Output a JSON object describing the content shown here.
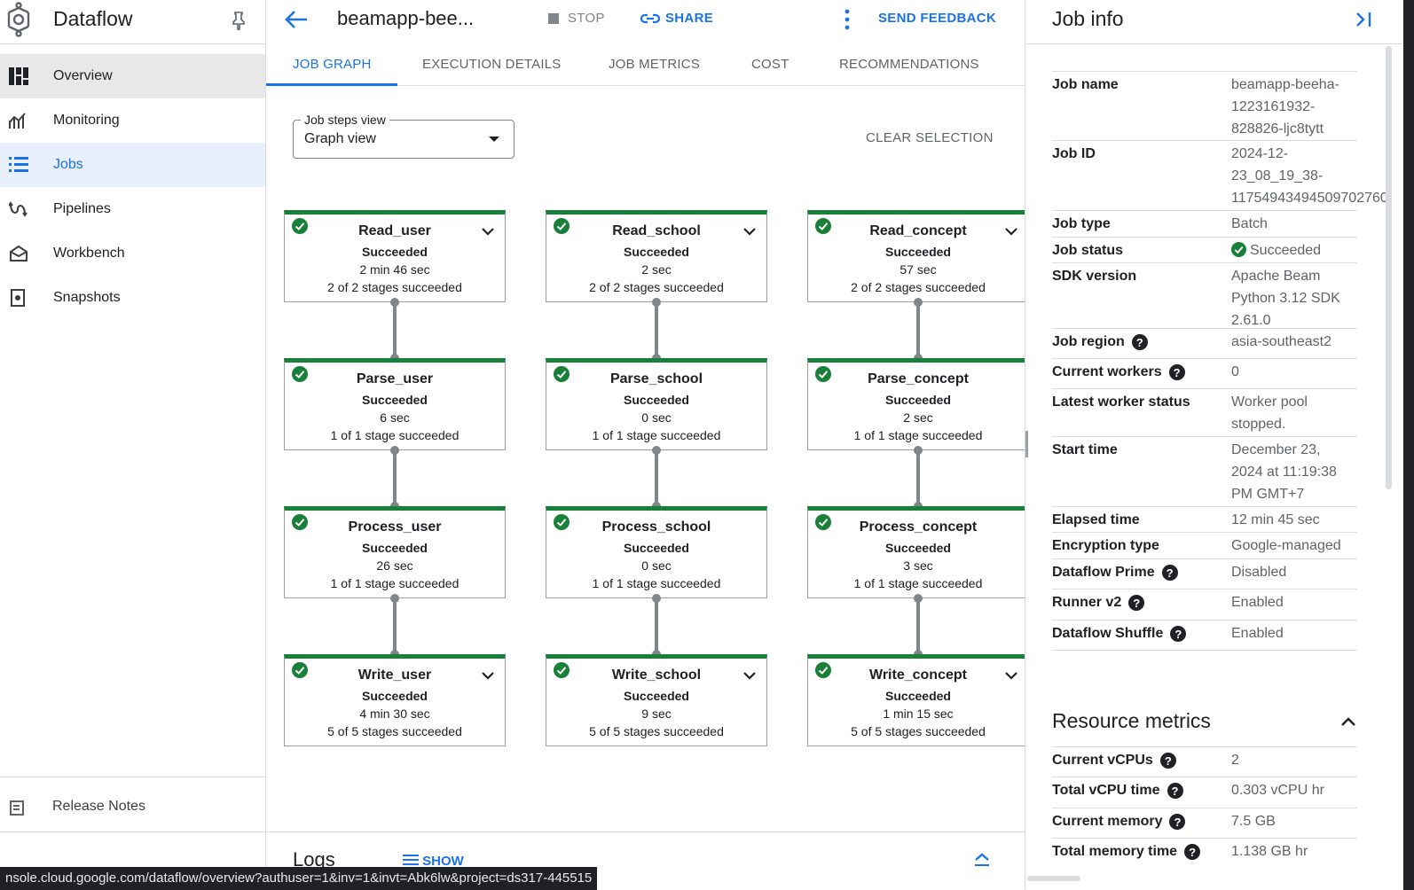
{
  "nav": {
    "title": "Dataflow",
    "items": [
      {
        "label": "Overview"
      },
      {
        "label": "Monitoring"
      },
      {
        "label": "Jobs"
      },
      {
        "label": "Pipelines"
      },
      {
        "label": "Workbench"
      },
      {
        "label": "Snapshots"
      }
    ],
    "release_notes": "Release Notes"
  },
  "header": {
    "job_title": "beamapp-bee...",
    "stop_label": "STOP",
    "share_label": "SHARE",
    "feedback_label": "SEND FEEDBACK"
  },
  "tabs": [
    {
      "label": "JOB GRAPH"
    },
    {
      "label": "EXECUTION DETAILS"
    },
    {
      "label": "JOB METRICS"
    },
    {
      "label": "COST"
    },
    {
      "label": "RECOMMENDATIONS"
    }
  ],
  "job_steps": {
    "label": "Job steps view",
    "value": "Graph view",
    "clear_label": "CLEAR SELECTION"
  },
  "graph": {
    "columns": [
      [
        {
          "name": "Read_user",
          "status": "Succeeded",
          "duration": "2 min 46 sec",
          "stages": "2 of 2 stages succeeded",
          "expandable": true
        },
        {
          "name": "Parse_user",
          "status": "Succeeded",
          "duration": "6 sec",
          "stages": "1 of 1 stage succeeded",
          "expandable": false
        },
        {
          "name": "Process_user",
          "status": "Succeeded",
          "duration": "26 sec",
          "stages": "1 of 1 stage succeeded",
          "expandable": false
        },
        {
          "name": "Write_user",
          "status": "Succeeded",
          "duration": "4 min 30 sec",
          "stages": "5 of 5 stages succeeded",
          "expandable": true
        }
      ],
      [
        {
          "name": "Read_school",
          "status": "Succeeded",
          "duration": "2 sec",
          "stages": "2 of 2 stages succeeded",
          "expandable": true
        },
        {
          "name": "Parse_school",
          "status": "Succeeded",
          "duration": "0 sec",
          "stages": "1 of 1 stage succeeded",
          "expandable": false
        },
        {
          "name": "Process_school",
          "status": "Succeeded",
          "duration": "0 sec",
          "stages": "1 of 1 stage succeeded",
          "expandable": false
        },
        {
          "name": "Write_school",
          "status": "Succeeded",
          "duration": "9 sec",
          "stages": "5 of 5 stages succeeded",
          "expandable": true
        }
      ],
      [
        {
          "name": "Read_concept",
          "status": "Succeeded",
          "duration": "57 sec",
          "stages": "2 of 2 stages succeeded",
          "expandable": true
        },
        {
          "name": "Parse_concept",
          "status": "Succeeded",
          "duration": "2 sec",
          "stages": "1 of 1 stage succeeded",
          "expandable": false
        },
        {
          "name": "Process_concept",
          "status": "Succeeded",
          "duration": "3 sec",
          "stages": "1 of 1 stage succeeded",
          "expandable": false
        },
        {
          "name": "Write_concept",
          "status": "Succeeded",
          "duration": "1 min 15 sec",
          "stages": "5 of 5 stages succeeded",
          "expandable": true
        }
      ]
    ]
  },
  "logs": {
    "title": "Logs",
    "show_label": "SHOW"
  },
  "job_info": {
    "title": "Job info",
    "rows": [
      {
        "key": "Job name",
        "value": "beamapp-beeha-1223161932-828826-ljc8tytt",
        "help": false
      },
      {
        "key": "Job ID",
        "value": "2024-12-23_08_19_38-11754943494509702760",
        "help": false
      },
      {
        "key": "Job type",
        "value": "Batch",
        "help": false
      },
      {
        "key": "Job status",
        "value": "Succeeded",
        "help": false,
        "status_icon": true
      },
      {
        "key": "SDK version",
        "value": "Apache Beam Python 3.12 SDK 2.61.0",
        "help": false
      },
      {
        "key": "Job region",
        "value": "asia-southeast2",
        "help": true
      },
      {
        "key": "Current workers",
        "value": "0",
        "help": true
      },
      {
        "key": "Latest worker status",
        "value": "Worker pool stopped.",
        "help": false
      },
      {
        "key": "Start time",
        "value": "December 23, 2024 at 11:19:38 PM GMT+7",
        "help": false
      },
      {
        "key": "Elapsed time",
        "value": "12 min 45 sec",
        "help": false
      },
      {
        "key": "Encryption type",
        "value": "Google-managed",
        "help": false
      },
      {
        "key": "Dataflow Prime",
        "value": "Disabled",
        "help": true
      },
      {
        "key": "Runner v2",
        "value": "Enabled",
        "help": true
      },
      {
        "key": "Dataflow Shuffle",
        "value": "Enabled",
        "help": true
      }
    ]
  },
  "resource_metrics": {
    "title": "Resource metrics",
    "rows": [
      {
        "key": "Current vCPUs",
        "value": "2",
        "help": true
      },
      {
        "key": "Total vCPU time",
        "value": "0.303 vCPU hr",
        "help": true
      },
      {
        "key": "Current memory",
        "value": "7.5 GB",
        "help": true
      },
      {
        "key": "Total memory time",
        "value": "1.138 GB hr",
        "help": true
      }
    ]
  },
  "status_url": "nsole.cloud.google.com/dataflow/overview?authuser=1&inv=1&invt=Abk6lw&project=ds317-445515",
  "colors": {
    "accent": "#1a73e8",
    "success": "#188038",
    "text_muted": "#5f6368"
  },
  "icons": {
    "logo": "dataflow-logo",
    "pin": "pin-icon",
    "back": "arrow-back-icon",
    "link": "link-icon",
    "check": "check-circle-icon",
    "help": "help-icon"
  }
}
